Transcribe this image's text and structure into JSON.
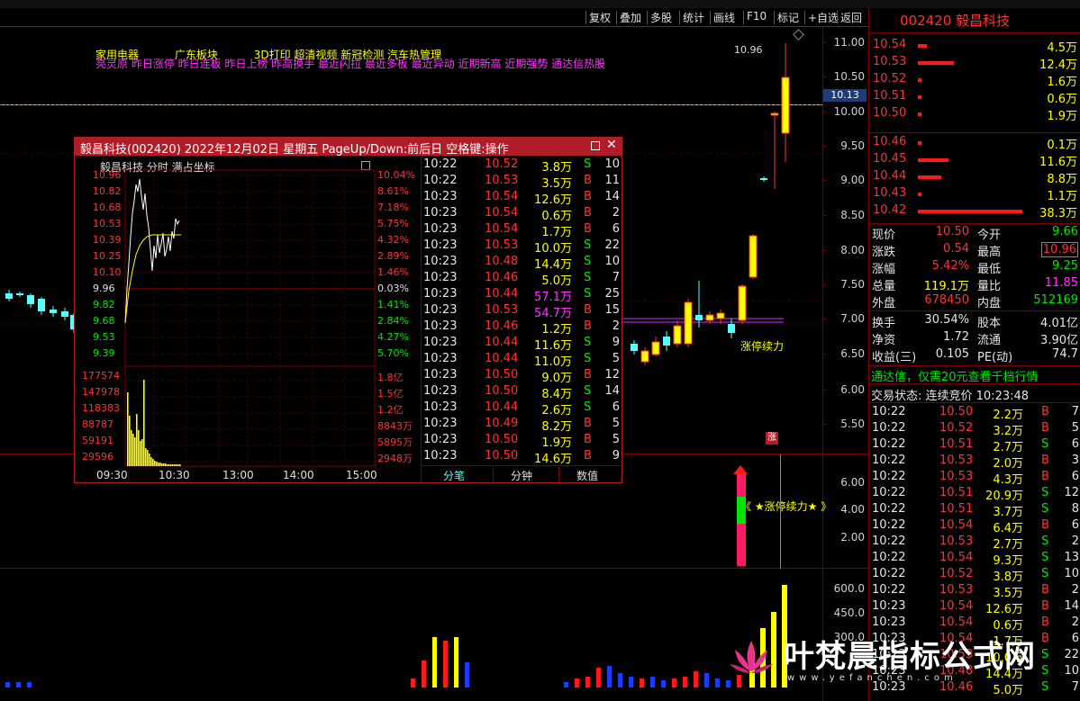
{
  "toolbar": {
    "buttons": [
      "复权",
      "叠加",
      "多股",
      "统计",
      "画线",
      "F10",
      "标记",
      "+自选",
      "返回"
    ]
  },
  "stock": {
    "code_name": "002420 毅昌科技"
  },
  "price_axis": [
    "11.00",
    "10.50",
    "10.00",
    "9.50",
    "9.00",
    "8.50",
    "8.00",
    "7.50",
    "7.00",
    "6.50",
    "6.00",
    "5.50"
  ],
  "current_price_tag": "10.13",
  "high_price_label": "10.96",
  "zt_label": "涨停续力",
  "zt_badge": "涨",
  "indicator_axis": [
    "6.00",
    "4.00",
    "2.00"
  ],
  "indicator_label": "《 ★涨停续力★ 》",
  "volume_axis": [
    "600.0",
    "450.0",
    "300.0"
  ],
  "sector_tags": {
    "line1": [
      "家用电器",
      "广东板块",
      "3D打印 超清视频 新冠检测 汽车热管理"
    ],
    "line2": "亮灵原 昨日涨停 昨日连板 昨日上榜 昨高换手 最近闪拉 最近多板 最近异动 近期新高 近期强势 通达信热股"
  },
  "orderbook": {
    "sell": [
      {
        "price": "10.54",
        "vol": "4.5万"
      },
      {
        "price": "10.53",
        "vol": "12.4万"
      },
      {
        "price": "10.52",
        "vol": "1.6万"
      },
      {
        "price": "10.51",
        "vol": "0.6万"
      },
      {
        "price": "10.50",
        "vol": "1.9万"
      }
    ],
    "buy": [
      {
        "price": "10.46",
        "vol": "0.1万"
      },
      {
        "price": "10.45",
        "vol": "11.6万"
      },
      {
        "price": "10.44",
        "vol": "8.8万"
      },
      {
        "price": "10.43",
        "vol": "1.1万"
      },
      {
        "price": "10.42",
        "vol": "38.3万"
      }
    ]
  },
  "quote": {
    "xj_label": "现价",
    "xj": "10.50",
    "jk_label": "今开",
    "jk": "9.66",
    "zd_label": "涨跌",
    "zd": "0.54",
    "zg_label": "最高",
    "zg": "10.96",
    "zf_label": "涨幅",
    "zf": "5.42%",
    "zdi_label": "最低",
    "zdi": "9.25",
    "zl_label": "总量",
    "zl": "119.1万",
    "lb_label": "量比",
    "lb": "11.85",
    "wp_label": "外盘",
    "wp": "678450",
    "np_label": "内盘",
    "np": "512169",
    "hs_label": "换手",
    "hs": "30.54%",
    "gb_label": "股本",
    "gb": "4.01亿",
    "jz_label": "净资",
    "jz": "1.72",
    "lt_label": "流通",
    "lt": "3.90亿",
    "sy_label": "收益(三)",
    "sy": "0.105",
    "pe_label": "PE(动)",
    "pe": "74.7"
  },
  "ad_text": "通达信，仅需20元查看千档行情",
  "trade_status": "交易状态: 连续竞价 10:23:48",
  "right_ticks": [
    [
      "10:22",
      "10.50",
      "2.2万",
      "B",
      "7"
    ],
    [
      "10:22",
      "10.52",
      "3.2万",
      "B",
      "5"
    ],
    [
      "10:22",
      "10.51",
      "2.7万",
      "S",
      "6"
    ],
    [
      "10:22",
      "10.53",
      "2.0万",
      "B",
      "3"
    ],
    [
      "10:22",
      "10.53",
      "4.3万",
      "B",
      "6"
    ],
    [
      "10:22",
      "10.51",
      "20.9万",
      "S",
      "12"
    ],
    [
      "10:22",
      "10.51",
      "3.7万",
      "S",
      "8"
    ],
    [
      "10:22",
      "10.54",
      "6.4万",
      "B",
      "6"
    ],
    [
      "10:22",
      "10.53",
      "2.7万",
      "S",
      "2"
    ],
    [
      "10:22",
      "10.54",
      "9.3万",
      "S",
      "13"
    ],
    [
      "10:22",
      "10.52",
      "3.8万",
      "S",
      "10"
    ],
    [
      "10:22",
      "10.53",
      "3.5万",
      "B",
      "2"
    ],
    [
      "10:23",
      "10.54",
      "12.6万",
      "B",
      "14"
    ],
    [
      "10:23",
      "10.54",
      "0.6万",
      "B",
      "2"
    ],
    [
      "10:23",
      "10.54",
      "1.7万",
      "B",
      "6"
    ],
    [
      "10:23",
      "10.53",
      "10.0万",
      "S",
      "22"
    ],
    [
      "10:23",
      "10.48",
      "14.4万",
      "S",
      "10"
    ],
    [
      "10:23",
      "10.46",
      "5.0万",
      "S",
      "7"
    ]
  ],
  "popup": {
    "title": "毅昌科技(002420) 2022年12月02日 星期五 PageUp/Down:前后日 空格键:操作",
    "chart_title": "毅昌科技  分时 满占坐标",
    "left_prices": [
      "10.96",
      "10.82",
      "10.68",
      "10.53",
      "10.39",
      "10.25",
      "10.10",
      "9.96",
      "9.82",
      "9.68",
      "9.53",
      "9.39"
    ],
    "right_pcts": [
      "10.04%",
      "8.61%",
      "7.18%",
      "5.75%",
      "4.32%",
      "2.89%",
      "1.46%",
      "0.03%",
      "1.41%",
      "2.84%",
      "4.27%",
      "5.70%"
    ],
    "vol_left": [
      "177574",
      "147978",
      "118383",
      "88787",
      "59191",
      "29596"
    ],
    "vol_right": [
      "1.8亿",
      "1.5亿",
      "1.2亿",
      "8843万",
      "5895万",
      "2948万"
    ],
    "time_axis": [
      "09:30",
      "10:30",
      "13:00",
      "14:00",
      "15:00"
    ],
    "tabs": [
      "分笔",
      "分钟",
      "数值"
    ],
    "ticks": [
      [
        "10:22",
        "10.52",
        "3.8万",
        "S",
        "10"
      ],
      [
        "10:22",
        "10.53",
        "3.5万",
        "B",
        "11"
      ],
      [
        "10:23",
        "10.54",
        "12.6万",
        "B",
        "14"
      ],
      [
        "10:23",
        "10.54",
        "0.6万",
        "B",
        "2"
      ],
      [
        "10:23",
        "10.54",
        "1.7万",
        "B",
        "6"
      ],
      [
        "10:23",
        "10.53",
        "10.0万",
        "S",
        "22"
      ],
      [
        "10:23",
        "10.48",
        "14.4万",
        "S",
        "10"
      ],
      [
        "10:23",
        "10.46",
        "5.0万",
        "S",
        "7"
      ],
      [
        "10:23",
        "10.44",
        "57.1万",
        "S",
        "25"
      ],
      [
        "10:23",
        "10.53",
        "54.7万",
        "B",
        "15"
      ],
      [
        "10:23",
        "10.46",
        "1.2万",
        "B",
        "2"
      ],
      [
        "10:23",
        "10.44",
        "11.6万",
        "S",
        "9"
      ],
      [
        "10:23",
        "10.44",
        "11.0万",
        "S",
        "5"
      ],
      [
        "10:23",
        "10.50",
        "9.0万",
        "B",
        "12"
      ],
      [
        "10:23",
        "10.50",
        "8.4万",
        "S",
        "14"
      ],
      [
        "10:23",
        "10.44",
        "2.6万",
        "S",
        "6"
      ],
      [
        "10:23",
        "10.49",
        "8.2万",
        "B",
        "5"
      ],
      [
        "10:23",
        "10.50",
        "1.9万",
        "B",
        "5"
      ],
      [
        "10:23",
        "10.50",
        "14.6万",
        "B",
        "9"
      ]
    ]
  },
  "watermark": {
    "text": "叶梵晨指标公式网",
    "url": "www.yefanchen.com"
  },
  "colors": {
    "up": "#ff3232",
    "down": "#00e600",
    "accent_red": "#b01c28",
    "yellow": "#ffff00",
    "cyan": "#54ffff"
  }
}
